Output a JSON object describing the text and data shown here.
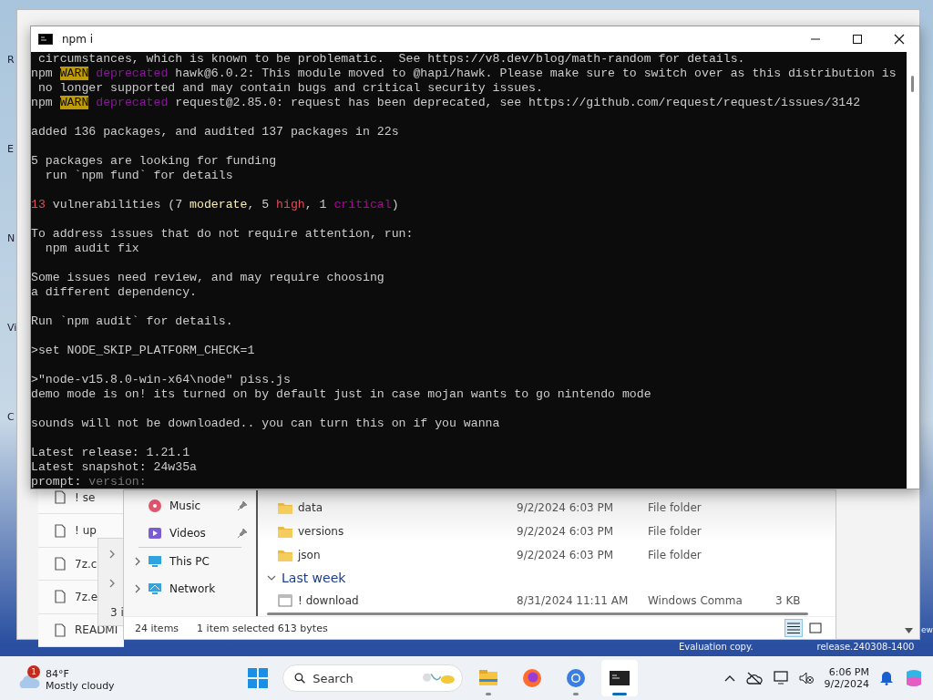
{
  "desktop": {
    "icon_labels": [
      "R",
      "E",
      "N",
      "Vi",
      "C"
    ],
    "edge_text": "ew",
    "watermark": [
      "Evaluation copy.",
      "release.240308-1400"
    ]
  },
  "background_window": {
    "files": [
      "! se",
      "! up",
      "7z.c",
      "7z.e",
      "READMI"
    ],
    "status": "3 i"
  },
  "explorer": {
    "nav": [
      {
        "label": "Music",
        "kind": "music",
        "pinned": true,
        "expandable": false
      },
      {
        "label": "Videos",
        "kind": "videos",
        "pinned": true,
        "expandable": false
      },
      {
        "label": "This PC",
        "kind": "pc",
        "pinned": false,
        "expandable": true
      },
      {
        "label": "Network",
        "kind": "network",
        "pinned": false,
        "expandable": true
      }
    ],
    "files": [
      {
        "name": "data",
        "date": "9/2/2024 6:03 PM",
        "type": "File folder",
        "kind": "folder"
      },
      {
        "name": "versions",
        "date": "9/2/2024 6:03 PM",
        "type": "File folder",
        "kind": "folder"
      },
      {
        "name": "json",
        "date": "9/2/2024 6:03 PM",
        "type": "File folder",
        "kind": "folder"
      }
    ],
    "group": {
      "header": "Last week",
      "expanded": true,
      "files": [
        {
          "name": "! download",
          "date": "8/31/2024 11:11 AM",
          "type": "Windows Comma",
          "size": "3 KB",
          "kind": "script"
        }
      ]
    },
    "status": {
      "items": "24 items",
      "selection": "1 item selected  613 bytes"
    },
    "view_buttons": [
      {
        "kind": "details",
        "selected": true
      },
      {
        "kind": "tiles",
        "selected": false
      }
    ]
  },
  "terminal": {
    "title": "npm i",
    "blocks": [
      [
        [
          {
            "text": " circumstances, which is known to be problematic.  See https://v8.dev/blog/math-random for details.",
            "kind": "text"
          }
        ],
        [
          {
            "text": "npm ",
            "kind": "text"
          },
          {
            "text": "WARN",
            "kind": "warn"
          },
          {
            "text": " deprecated",
            "kind": "dep"
          },
          {
            "text": " hawk@6.0.2: This module moved to @hapi/hawk. Please make sure to switch over as this distribution is",
            "kind": "text"
          }
        ],
        [
          {
            "text": " no longer supported and may contain bugs and critical security issues.",
            "kind": "text"
          }
        ],
        [
          {
            "text": "npm ",
            "kind": "text"
          },
          {
            "text": "WARN",
            "kind": "warn"
          },
          {
            "text": " deprecated",
            "kind": "dep"
          },
          {
            "text": " request@2.85.0: request has been deprecated, see https://github.com/request/request/issues/3142",
            "kind": "text"
          }
        ]
      ],
      [
        [
          {
            "text": "added 136 packages, and audited 137 packages in 22s",
            "kind": "text"
          }
        ]
      ],
      [
        [
          {
            "text": "5 packages are looking for funding",
            "kind": "text"
          }
        ],
        [
          {
            "text": "  run `npm fund` for details",
            "kind": "text"
          }
        ]
      ],
      [
        [
          {
            "text": "13",
            "kind": "red"
          },
          {
            "text": " vulnerabilities (7 ",
            "kind": "text"
          },
          {
            "text": "moderate",
            "kind": "yellow"
          },
          {
            "text": ", 5 ",
            "kind": "text"
          },
          {
            "text": "high",
            "kind": "red"
          },
          {
            "text": ", 1 ",
            "kind": "text"
          },
          {
            "text": "critical",
            "kind": "magenta"
          },
          {
            "text": ")",
            "kind": "text"
          }
        ]
      ],
      [
        [
          {
            "text": "To address issues that do not require attention, run:",
            "kind": "text"
          }
        ],
        [
          {
            "text": "  npm audit fix",
            "kind": "text"
          }
        ]
      ],
      [
        [
          {
            "text": "Some issues need review, and may require choosing",
            "kind": "text"
          }
        ],
        [
          {
            "text": "a different dependency.",
            "kind": "text"
          }
        ]
      ],
      [
        [
          {
            "text": "Run `npm audit` for details.",
            "kind": "text"
          }
        ]
      ],
      [
        [
          {
            "text": ">set NODE_SKIP_PLATFORM_CHECK=1",
            "kind": "text"
          }
        ]
      ],
      [
        [
          {
            "text": ">\"node-v15.8.0-win-x64\\node\" piss.js",
            "kind": "text"
          }
        ],
        [
          {
            "text": "demo mode is on! its turned on by default just in case mojan wants to go nintendo mode",
            "kind": "text"
          }
        ]
      ],
      [
        [
          {
            "text": "sounds will not be downloaded.. you can turn this on if you wanna",
            "kind": "text"
          }
        ]
      ],
      [
        [
          {
            "text": "Latest release: 1.21.1",
            "kind": "text"
          }
        ],
        [
          {
            "text": "Latest snapshot: 24w35a",
            "kind": "text"
          }
        ],
        [
          {
            "text": "prompt: ",
            "kind": "text"
          },
          {
            "text": "version:",
            "kind": "dim"
          }
        ]
      ]
    ]
  },
  "taskbar": {
    "weather": {
      "badge": "1",
      "temp": "84°F",
      "condition": "Mostly cloudy"
    },
    "search": {
      "placeholder": "Search"
    },
    "apps": [
      {
        "kind": "explorer",
        "running": true,
        "active": false
      },
      {
        "kind": "firefox",
        "running": false,
        "active": false
      },
      {
        "kind": "chrome",
        "running": true,
        "active": false
      },
      {
        "kind": "terminal",
        "running": true,
        "active": true
      }
    ],
    "clock": {
      "time": "6:06 PM",
      "date": "9/2/2024"
    }
  }
}
